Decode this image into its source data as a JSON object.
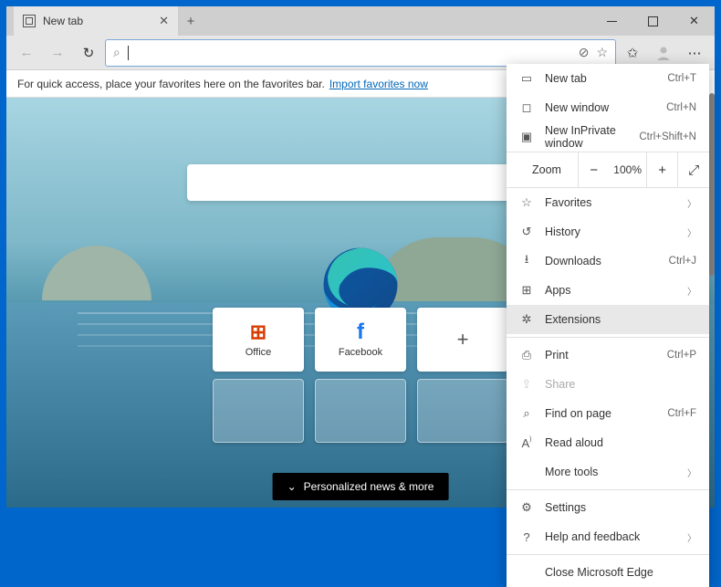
{
  "tab": {
    "title": "New tab"
  },
  "favbar": {
    "text": "For quick access, place your favorites here on the favorites bar.",
    "link": "Import favorites now"
  },
  "tiles": [
    {
      "label": "Office"
    },
    {
      "label": "Facebook"
    }
  ],
  "news_button": "Personalized news & more",
  "menu": {
    "new_tab": "New tab",
    "new_tab_sc": "Ctrl+T",
    "new_window": "New window",
    "new_window_sc": "Ctrl+N",
    "new_inprivate": "New InPrivate window",
    "new_inprivate_sc": "Ctrl+Shift+N",
    "zoom": "Zoom",
    "zoom_val": "100%",
    "favorites": "Favorites",
    "history": "History",
    "downloads": "Downloads",
    "downloads_sc": "Ctrl+J",
    "apps": "Apps",
    "extensions": "Extensions",
    "print": "Print",
    "print_sc": "Ctrl+P",
    "share": "Share",
    "find": "Find on page",
    "find_sc": "Ctrl+F",
    "read_aloud": "Read aloud",
    "more_tools": "More tools",
    "settings": "Settings",
    "help": "Help and feedback",
    "close": "Close Microsoft Edge"
  }
}
